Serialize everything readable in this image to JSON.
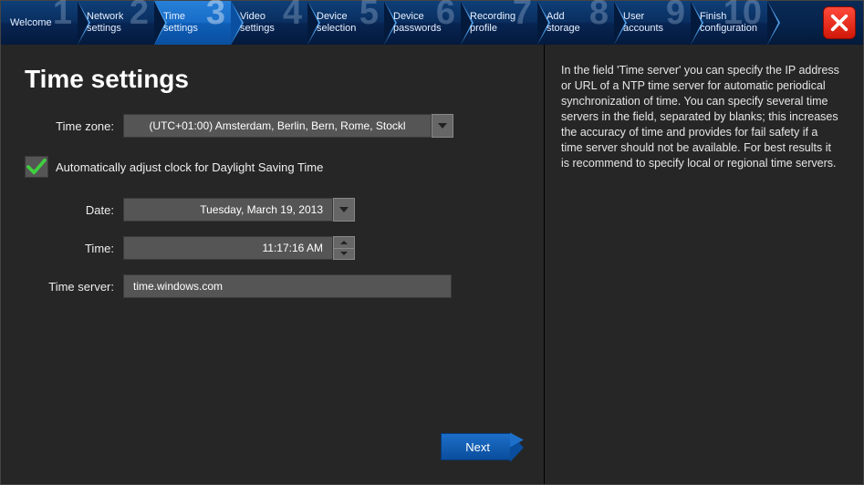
{
  "steps": [
    {
      "num": "1",
      "label": "Welcome"
    },
    {
      "num": "2",
      "label": "Network\nsettings"
    },
    {
      "num": "3",
      "label": "Time\nsettings"
    },
    {
      "num": "4",
      "label": "Video\nsettings"
    },
    {
      "num": "5",
      "label": "Device\nselection"
    },
    {
      "num": "6",
      "label": "Device\npasswords"
    },
    {
      "num": "7",
      "label": "Recording\nprofile"
    },
    {
      "num": "8",
      "label": "Add\nstorage"
    },
    {
      "num": "9",
      "label": "User\naccounts"
    },
    {
      "num": "10",
      "label": "Finish\nconfiguration"
    }
  ],
  "active_step_index": 2,
  "page": {
    "title": "Time settings",
    "labels": {
      "timezone": "Time zone:",
      "date": "Date:",
      "time": "Time:",
      "timeserver": "Time server:",
      "dst": "Automatically adjust clock for Daylight Saving Time"
    },
    "values": {
      "timezone": "(UTC+01:00) Amsterdam, Berlin, Bern, Rome, Stockl",
      "date": "Tuesday, March 19, 2013",
      "time": "11:17:16 AM",
      "timeserver": "time.windows.com",
      "dst_checked": true
    },
    "next_label": "Next"
  },
  "help_text": "In the field 'Time server' you can specify the IP address or URL of a NTP time server for automatic periodical synchronization of time. You can specify several time servers in the field, separated by blanks; this increases the accuracy of time and provides for fail safety if a time server should not be available. For best results it is recommend to specify local or regional time servers."
}
